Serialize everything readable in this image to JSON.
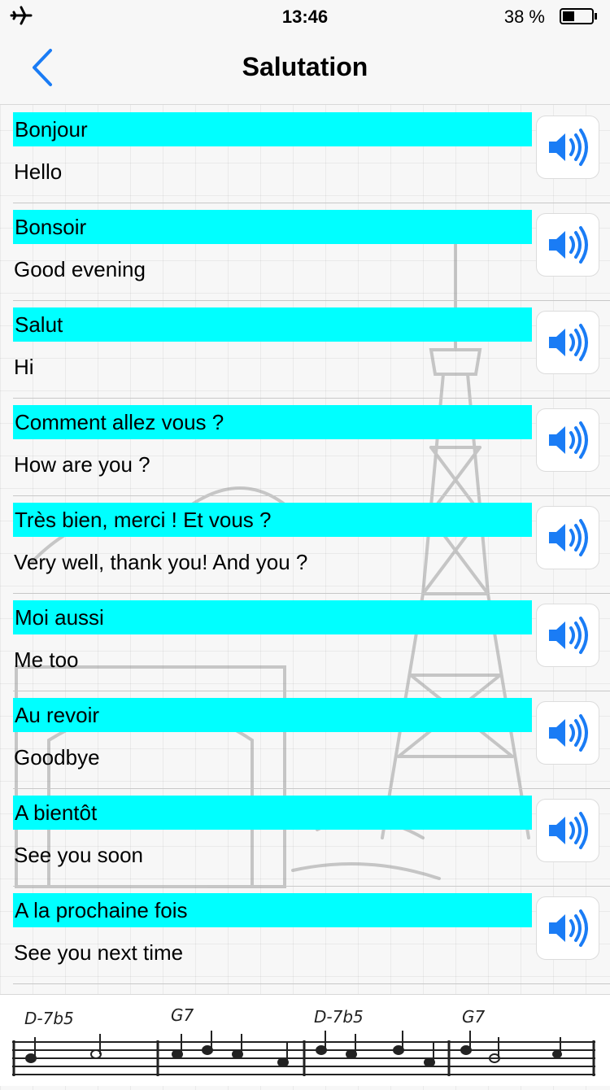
{
  "status_bar": {
    "time": "13:46",
    "battery_text": "38 %"
  },
  "nav": {
    "title": "Salutation"
  },
  "phrases": [
    {
      "french": "Bonjour",
      "english": "Hello"
    },
    {
      "french": "Bonsoir",
      "english": "Good evening"
    },
    {
      "french": "Salut",
      "english": "Hi"
    },
    {
      "french": "Comment allez vous ?",
      "english": "How are you ?"
    },
    {
      "french": "Très bien, merci ! Et vous ?",
      "english": "Very well, thank you! And you ?"
    },
    {
      "french": "Moi aussi",
      "english": "Me too"
    },
    {
      "french": "Au revoir",
      "english": "Goodbye"
    },
    {
      "french": "A bientôt",
      "english": "See you soon"
    },
    {
      "french": "A la prochaine fois",
      "english": "See you next time"
    }
  ],
  "banner": {
    "chords": [
      "D-7b5",
      "G7",
      "D-7b5",
      "G7"
    ]
  },
  "colors": {
    "highlight": "#00ffff",
    "accent": "#1a7cf5"
  },
  "icons": {
    "back": "chevron-left-icon",
    "play": "speaker-icon",
    "airplane": "airplane-icon",
    "battery": "battery-icon"
  }
}
